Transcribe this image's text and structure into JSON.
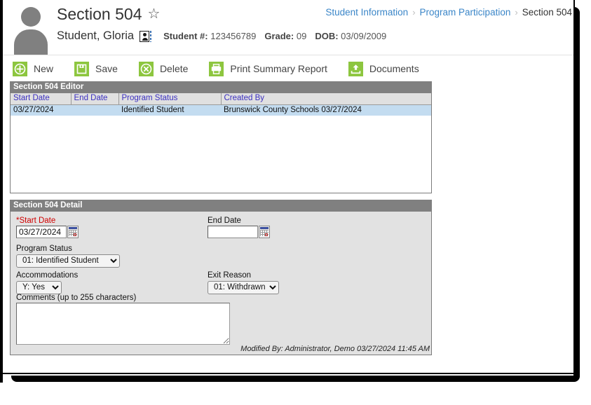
{
  "header": {
    "title": "Section 504",
    "favorite_icon": "star-icon",
    "avatar_icon": "person-avatar-icon",
    "student_name": "Student, Gloria",
    "idcard_icon": "id-card-icon",
    "student_number_label": "Student #:",
    "student_number_value": "123456789",
    "grade_label": "Grade:",
    "grade_value": "09",
    "dob_label": "DOB:",
    "dob_value": "03/09/2009"
  },
  "breadcrumb": {
    "items": [
      {
        "label": "Student Information",
        "link": true
      },
      {
        "label": "Program Participation",
        "link": true
      },
      {
        "label": "Section 504",
        "link": false
      }
    ],
    "separator": "›"
  },
  "toolbar": {
    "buttons": [
      {
        "label": "New",
        "icon": "plus-circle-icon"
      },
      {
        "label": "Save",
        "icon": "floppy-disk-icon"
      },
      {
        "label": "Delete",
        "icon": "x-circle-icon"
      },
      {
        "label": "Print Summary Report",
        "icon": "printer-icon"
      },
      {
        "label": "Documents",
        "icon": "upload-document-icon"
      }
    ]
  },
  "editor": {
    "title": "Section 504 Editor",
    "columns": [
      "Start Date",
      "End Date",
      "Program Status",
      "Created By"
    ],
    "rows": [
      {
        "start_date": "03/27/2024",
        "end_date": "",
        "program_status": "Identified Student",
        "created_by": "Brunswick County Schools 03/27/2024",
        "selected": true
      }
    ]
  },
  "detail": {
    "title": "Section 504 Detail",
    "start_date": {
      "label": "*Start Date",
      "value": "03/27/2024",
      "placeholder": "",
      "calendar_icon": "calendar-icon"
    },
    "end_date": {
      "label": "End Date",
      "value": "",
      "placeholder": "",
      "calendar_icon": "calendar-icon"
    },
    "program_status": {
      "label": "Program Status",
      "value": "01: Identified Student",
      "options": [
        "01: Identified Student"
      ]
    },
    "accommodations": {
      "label": "Accommodations",
      "value": "Y: Yes",
      "options": [
        "Y: Yes"
      ]
    },
    "exit_reason": {
      "label": "Exit Reason",
      "value": "01: Withdrawn",
      "options": [
        "01: Withdrawn"
      ]
    },
    "comments": {
      "label": "Comments (up to 255 characters)",
      "value": "",
      "placeholder": ""
    },
    "modified_by": "Modified By: Administrator, Demo 03/27/2024 11:45 AM"
  },
  "colors": {
    "accent_green": "#8dc63f",
    "link_blue": "#3b86c8",
    "header_gray": "#808080",
    "row_selected": "#c3dcf0",
    "column_header_text": "#3b2fc0",
    "required_red": "#d00000"
  }
}
